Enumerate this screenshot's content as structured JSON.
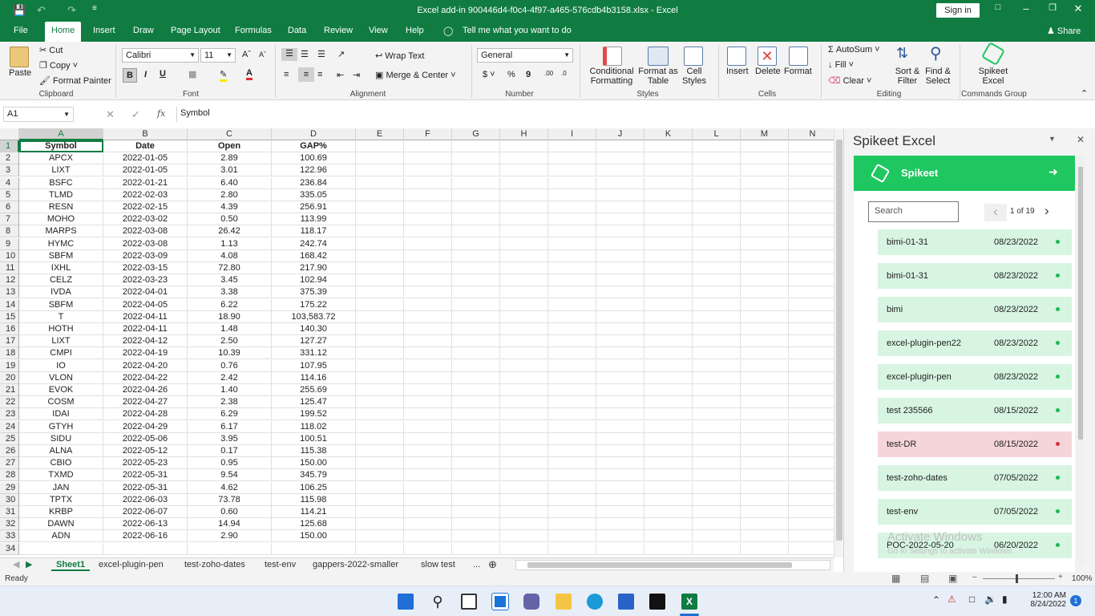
{
  "window": {
    "title": "Excel add-in 900446d4-f0c4-4f97-a465-576cdb4b3158.xlsx  -  Excel",
    "sign_in": "Sign in"
  },
  "menu_tabs": [
    "File",
    "Home",
    "Insert",
    "Draw",
    "Page Layout",
    "Formulas",
    "Data",
    "Review",
    "View",
    "Help"
  ],
  "tell_me": "Tell me what you want to do",
  "share": "Share",
  "ribbon": {
    "clipboard": {
      "paste": "Paste",
      "cut": "Cut",
      "copy": "Copy",
      "format_painter": "Format Painter",
      "label": "Clipboard"
    },
    "font": {
      "name": "Calibri",
      "size": "11",
      "label": "Font",
      "bold": "B",
      "italic": "I",
      "underline": "U"
    },
    "alignment": {
      "wrap_text": "Wrap Text",
      "merge_center": "Merge & Center",
      "label": "Alignment"
    },
    "number": {
      "format": "General",
      "label": "Number"
    },
    "styles": {
      "conditional": "Conditional",
      "conditional2": "Formatting",
      "format_as": "Format as",
      "format_as2": "Table",
      "cell": "Cell",
      "cell2": "Styles",
      "label": "Styles"
    },
    "cells": {
      "insert": "Insert",
      "delete": "Delete",
      "format": "Format",
      "label": "Cells"
    },
    "editing": {
      "autosum": "AutoSum",
      "fill": "Fill",
      "clear": "Clear",
      "sort": "Sort &",
      "sort2": "Filter",
      "find": "Find &",
      "find2": "Select",
      "label": "Editing"
    },
    "commands": {
      "spikeet": "Spikeet",
      "excel": "Excel",
      "label": "Commands Group"
    }
  },
  "formula_bar": {
    "name_box": "A1",
    "fx": "fx",
    "content": "Symbol"
  },
  "columns": [
    "A",
    "B",
    "C",
    "D",
    "E",
    "F",
    "G",
    "H",
    "I",
    "J",
    "K",
    "L",
    "M",
    "N"
  ],
  "rows": [
    [
      "Symbol",
      "Date",
      "Open",
      "GAP%"
    ],
    [
      "APCX",
      "2022-01-05",
      "2.89",
      "100.69"
    ],
    [
      "LIXT",
      "2022-01-05",
      "3.01",
      "122.96"
    ],
    [
      "BSFC",
      "2022-01-21",
      "6.40",
      "236.84"
    ],
    [
      "TLMD",
      "2022-02-03",
      "2.80",
      "335.05"
    ],
    [
      "RESN",
      "2022-02-15",
      "4.39",
      "256.91"
    ],
    [
      "MOHO",
      "2022-03-02",
      "0.50",
      "113.99"
    ],
    [
      "MARPS",
      "2022-03-08",
      "26.42",
      "118.17"
    ],
    [
      "HYMC",
      "2022-03-08",
      "1.13",
      "242.74"
    ],
    [
      "SBFM",
      "2022-03-09",
      "4.08",
      "168.42"
    ],
    [
      "IXHL",
      "2022-03-15",
      "72.80",
      "217.90"
    ],
    [
      "CELZ",
      "2022-03-23",
      "3.45",
      "102.94"
    ],
    [
      "IVDA",
      "2022-04-01",
      "3.38",
      "375.39"
    ],
    [
      "SBFM",
      "2022-04-05",
      "6.22",
      "175.22"
    ],
    [
      "T",
      "2022-04-11",
      "18.90",
      "103,583.72"
    ],
    [
      "HOTH",
      "2022-04-11",
      "1.48",
      "140.30"
    ],
    [
      "LIXT",
      "2022-04-12",
      "2.50",
      "127.27"
    ],
    [
      "CMPI",
      "2022-04-19",
      "10.39",
      "331.12"
    ],
    [
      "IO",
      "2022-04-20",
      "0.76",
      "107.95"
    ],
    [
      "VLON",
      "2022-04-22",
      "2.42",
      "114.16"
    ],
    [
      "EVOK",
      "2022-04-26",
      "1.40",
      "255.69"
    ],
    [
      "COSM",
      "2022-04-27",
      "2.38",
      "125.47"
    ],
    [
      "IDAI",
      "2022-04-28",
      "6.29",
      "199.52"
    ],
    [
      "GTYH",
      "2022-04-29",
      "6.17",
      "118.02"
    ],
    [
      "SIDU",
      "2022-05-06",
      "3.95",
      "100.51"
    ],
    [
      "ALNA",
      "2022-05-12",
      "0.17",
      "115.38"
    ],
    [
      "CBIO",
      "2022-05-23",
      "0.95",
      "150.00"
    ],
    [
      "TXMD",
      "2022-05-31",
      "9.54",
      "345.79"
    ],
    [
      "JAN",
      "2022-05-31",
      "4.62",
      "106.25"
    ],
    [
      "TPTX",
      "2022-06-03",
      "73.78",
      "115.98"
    ],
    [
      "KRBP",
      "2022-06-07",
      "0.60",
      "114.21"
    ],
    [
      "DAWN",
      "2022-06-13",
      "14.94",
      "125.68"
    ],
    [
      "ADN",
      "2022-06-16",
      "2.90",
      "150.00"
    ]
  ],
  "sheet_tabs": [
    "Sheet1",
    "excel-plugin-pen",
    "test-zoho-dates",
    "test-env",
    "gappers-2022-smaller",
    "slow test"
  ],
  "status": {
    "ready": "Ready",
    "zoom": "100%"
  },
  "pane": {
    "title": "Spikeet Excel",
    "brand": "Spikeet",
    "search_placeholder": "Search",
    "page": "1 of 19",
    "items": [
      {
        "name": "bimi-01-31",
        "date": "08/23/2022",
        "status": "ok"
      },
      {
        "name": "bimi-01-31",
        "date": "08/23/2022",
        "status": "ok"
      },
      {
        "name": "bimi",
        "date": "08/23/2022",
        "status": "ok"
      },
      {
        "name": "excel-plugin-pen22",
        "date": "08/23/2022",
        "status": "ok"
      },
      {
        "name": "excel-plugin-pen",
        "date": "08/23/2022",
        "status": "ok"
      },
      {
        "name": "test 235566",
        "date": "08/15/2022",
        "status": "ok"
      },
      {
        "name": "test-DR",
        "date": "08/15/2022",
        "status": "error"
      },
      {
        "name": "test-zoho-dates",
        "date": "07/05/2022",
        "status": "ok"
      },
      {
        "name": "test-env",
        "date": "07/05/2022",
        "status": "ok"
      },
      {
        "name": "POC-2022-05-20",
        "date": "06/20/2022",
        "status": "ok"
      }
    ],
    "watermark1": "Activate Windows",
    "watermark2": "Go to Settings to activate Windows."
  },
  "taskbar": {
    "time": "12:00 AM",
    "date": "8/24/2022",
    "notifications": "1"
  },
  "colors": {
    "excel_green": "#107c41",
    "spikeet_green": "#1ec760",
    "item_ok": "#d7f5e1",
    "item_error": "#f6d5d9"
  }
}
